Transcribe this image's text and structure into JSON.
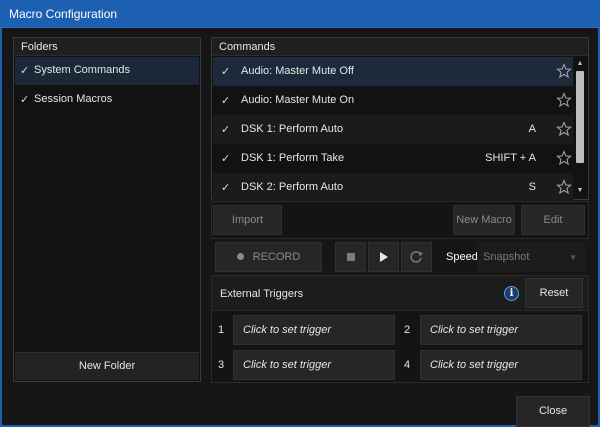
{
  "window": {
    "title": "Macro Configuration"
  },
  "folders": {
    "header": "Folders",
    "items": [
      {
        "label": "System Commands",
        "checked": "✓"
      },
      {
        "label": "Session Macros",
        "checked": "✓"
      }
    ],
    "new_folder_label": "New Folder"
  },
  "commands": {
    "header": "Commands",
    "rows": [
      {
        "check": "✓",
        "label": "Audio: Master Mute Off",
        "shortcut": ""
      },
      {
        "check": "✓",
        "label": "Audio: Master Mute On",
        "shortcut": ""
      },
      {
        "check": "✓",
        "label": "DSK 1: Perform Auto",
        "shortcut": "A"
      },
      {
        "check": "✓",
        "label": "DSK 1: Perform Take",
        "shortcut": "SHIFT + A"
      },
      {
        "check": "✓",
        "label": "DSK 2: Perform Auto",
        "shortcut": "S"
      }
    ],
    "import_label": "Import",
    "new_macro_label": "New Macro",
    "edit_label": "Edit"
  },
  "transport": {
    "record_label": "RECORD",
    "speed_label": "Speed",
    "speed_value": "Snapshot"
  },
  "triggers": {
    "title": "External Triggers",
    "reset_label": "Reset",
    "info_glyph": "i",
    "slots": [
      {
        "number": "1",
        "placeholder": "Click to set trigger"
      },
      {
        "number": "2",
        "placeholder": "Click to set trigger"
      },
      {
        "number": "3",
        "placeholder": "Click to set trigger"
      },
      {
        "number": "4",
        "placeholder": "Click to set trigger"
      }
    ]
  },
  "close_label": "Close",
  "colors": {
    "title_bar": "#1d5fb0",
    "selected_row": "#1c2a3b",
    "info_accent": "#5aa0e8"
  },
  "icons": [
    "check-icon",
    "star-icon",
    "record-dot-icon",
    "stop-icon",
    "play-icon",
    "loop-icon",
    "info-icon",
    "scroll-up-icon",
    "scroll-down-icon"
  ]
}
